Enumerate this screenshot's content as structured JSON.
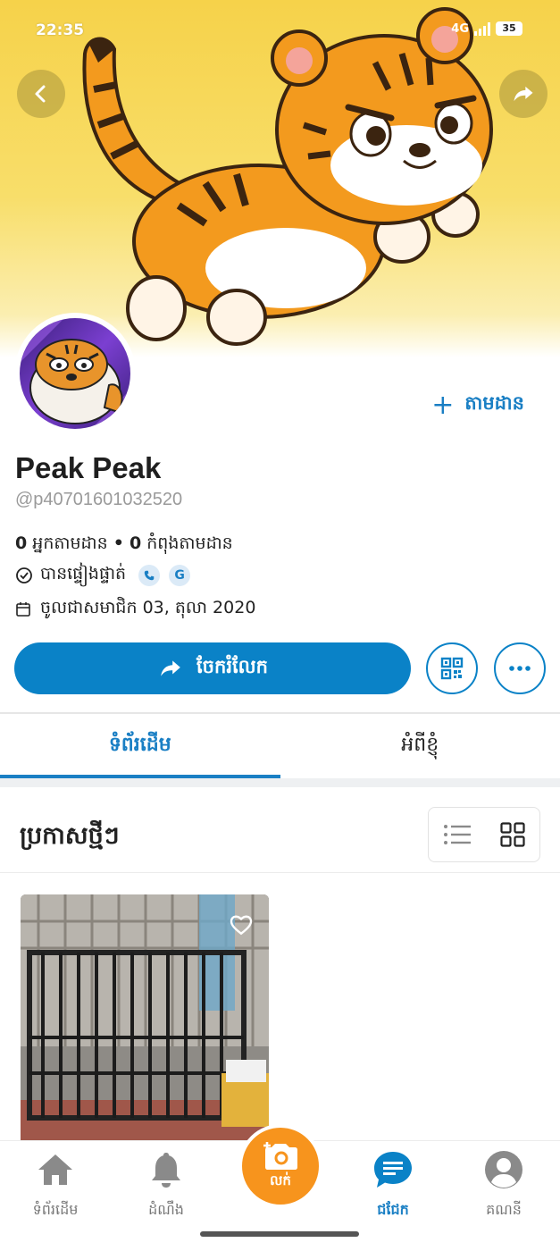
{
  "status_bar": {
    "time": "22:35",
    "network": "4G",
    "battery": "35"
  },
  "profile": {
    "name": "Peak Peak",
    "handle": "@p40701601032520",
    "followers_count": "0",
    "followers_label": "អ្នកតាមដាន",
    "separator": "•",
    "following_count": "0",
    "following_label": "កំពុងតាមដាន",
    "verified_label": "បានផ្ទៀងផ្ទាត់",
    "verify_google": "G",
    "joined_label": "ចូលជាសមាជិក 03, តុលា 2020",
    "follow_label": "តាមដាន"
  },
  "actions": {
    "share_label": "ចែករំលែក"
  },
  "tabs": [
    {
      "label": "ទំព័រដើម",
      "active": true
    },
    {
      "label": "អំពីខ្ញុំ",
      "active": false
    }
  ],
  "posts": {
    "title": "ប្រកាសថ្មីៗ",
    "view_mode": "grid"
  },
  "bottom_nav": {
    "home": "ទំព័រដើម",
    "notifications": "ដំណឹង",
    "sell": "លក់",
    "chat": "ជជែក",
    "account": "គណនី"
  },
  "colors": {
    "accent": "#0a82c7",
    "sell": "#f7941d",
    "cover": "#f6d24a"
  }
}
